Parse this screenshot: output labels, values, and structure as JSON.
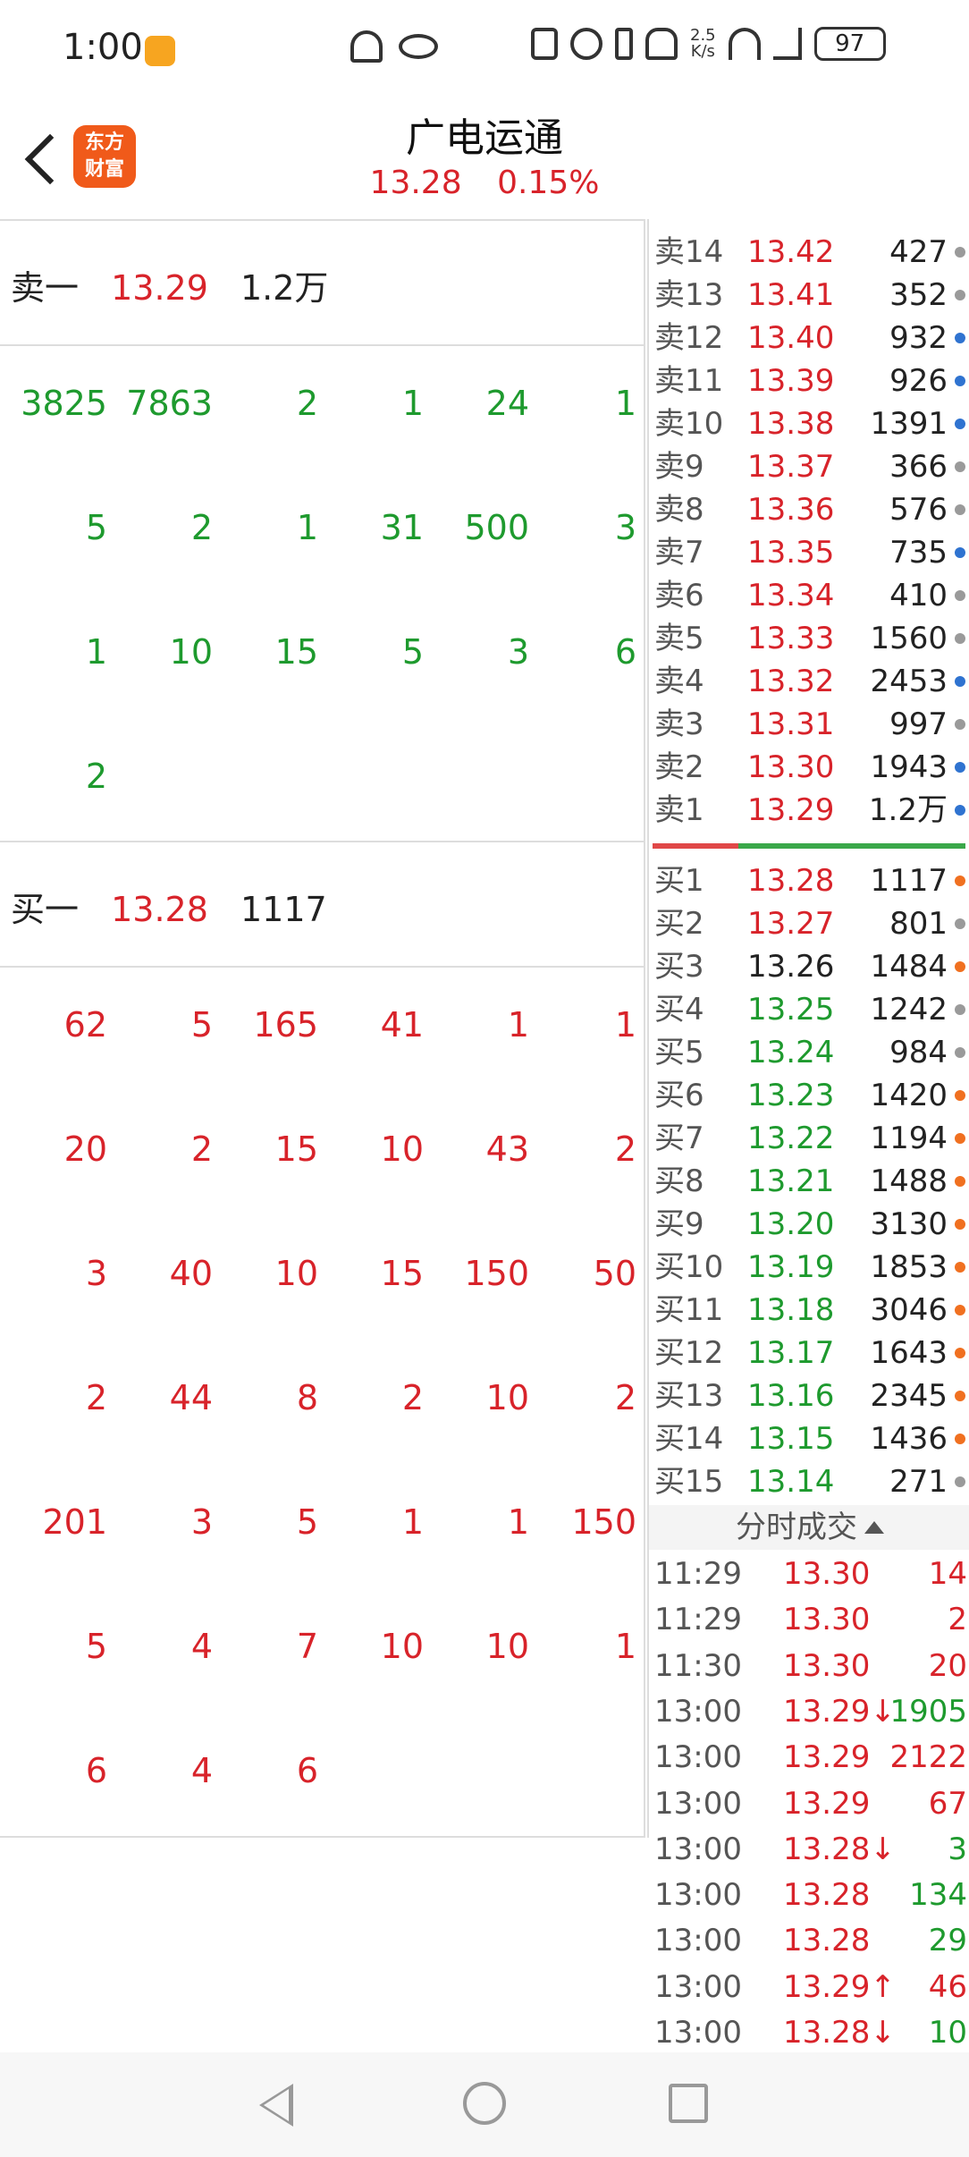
{
  "status_bar": {
    "time": "1:00",
    "net_speed_value": "2.5",
    "net_speed_unit": "K/s",
    "battery": "97"
  },
  "header": {
    "title": "广电运通",
    "price": "13.28",
    "change_pct": "0.15%",
    "logo_text_line1": "东方",
    "logo_text_line2": "财富"
  },
  "left_panel": {
    "sell": {
      "label": "卖一",
      "price": "13.29",
      "volume": "1.2万",
      "orders": [
        [
          "3825",
          "7863",
          "2",
          "1",
          "24",
          "1"
        ],
        [
          "5",
          "2",
          "1",
          "31",
          "500",
          "3"
        ],
        [
          "1",
          "10",
          "15",
          "5",
          "3",
          "6"
        ],
        [
          "2"
        ]
      ]
    },
    "buy": {
      "label": "买一",
      "price": "13.28",
      "volume": "1117",
      "orders": [
        [
          "62",
          "5",
          "165",
          "41",
          "1",
          "1"
        ],
        [
          "20",
          "2",
          "15",
          "10",
          "43",
          "2"
        ],
        [
          "3",
          "40",
          "10",
          "15",
          "150",
          "50"
        ],
        [
          "2",
          "44",
          "8",
          "2",
          "10",
          "2"
        ],
        [
          "201",
          "3",
          "5",
          "1",
          "1",
          "150"
        ],
        [
          "5",
          "4",
          "7",
          "10",
          "10",
          "1"
        ],
        [
          "6",
          "4",
          "6"
        ]
      ]
    }
  },
  "order_book": {
    "sells": [
      {
        "label": "卖14",
        "price": "13.42",
        "volume": "427",
        "dot": "gray"
      },
      {
        "label": "卖13",
        "price": "13.41",
        "volume": "352",
        "dot": "gray"
      },
      {
        "label": "卖12",
        "price": "13.40",
        "volume": "932",
        "dot": "blue"
      },
      {
        "label": "卖11",
        "price": "13.39",
        "volume": "926",
        "dot": "blue"
      },
      {
        "label": "卖10",
        "price": "13.38",
        "volume": "1391",
        "dot": "blue"
      },
      {
        "label": "卖9",
        "price": "13.37",
        "volume": "366",
        "dot": "gray"
      },
      {
        "label": "卖8",
        "price": "13.36",
        "volume": "576",
        "dot": "gray"
      },
      {
        "label": "卖7",
        "price": "13.35",
        "volume": "735",
        "dot": "blue"
      },
      {
        "label": "卖6",
        "price": "13.34",
        "volume": "410",
        "dot": "gray"
      },
      {
        "label": "卖5",
        "price": "13.33",
        "volume": "1560",
        "dot": "gray"
      },
      {
        "label": "卖4",
        "price": "13.32",
        "volume": "2453",
        "dot": "blue"
      },
      {
        "label": "卖3",
        "price": "13.31",
        "volume": "997",
        "dot": "gray"
      },
      {
        "label": "卖2",
        "price": "13.30",
        "volume": "1943",
        "dot": "blue"
      },
      {
        "label": "卖1",
        "price": "13.29",
        "volume": "1.2万",
        "dot": "blue"
      }
    ],
    "buys": [
      {
        "label": "买1",
        "price": "13.28",
        "volume": "1117",
        "dot": "orange",
        "price_color": "red"
      },
      {
        "label": "买2",
        "price": "13.27",
        "volume": "801",
        "dot": "gray",
        "price_color": "red"
      },
      {
        "label": "买3",
        "price": "13.26",
        "volume": "1484",
        "dot": "orange",
        "price_color": "dark"
      },
      {
        "label": "买4",
        "price": "13.25",
        "volume": "1242",
        "dot": "gray",
        "price_color": "green"
      },
      {
        "label": "买5",
        "price": "13.24",
        "volume": "984",
        "dot": "gray",
        "price_color": "green"
      },
      {
        "label": "买6",
        "price": "13.23",
        "volume": "1420",
        "dot": "orange",
        "price_color": "green"
      },
      {
        "label": "买7",
        "price": "13.22",
        "volume": "1194",
        "dot": "orange",
        "price_color": "green"
      },
      {
        "label": "买8",
        "price": "13.21",
        "volume": "1488",
        "dot": "orange",
        "price_color": "green"
      },
      {
        "label": "买9",
        "price": "13.20",
        "volume": "3130",
        "dot": "orange",
        "price_color": "green"
      },
      {
        "label": "买10",
        "price": "13.19",
        "volume": "1853",
        "dot": "orange",
        "price_color": "green"
      },
      {
        "label": "买11",
        "price": "13.18",
        "volume": "3046",
        "dot": "orange",
        "price_color": "green"
      },
      {
        "label": "买12",
        "price": "13.17",
        "volume": "1643",
        "dot": "orange",
        "price_color": "green"
      },
      {
        "label": "买13",
        "price": "13.16",
        "volume": "2345",
        "dot": "orange",
        "price_color": "green"
      },
      {
        "label": "买14",
        "price": "13.15",
        "volume": "1436",
        "dot": "orange",
        "price_color": "green"
      },
      {
        "label": "买15",
        "price": "13.14",
        "volume": "271",
        "dot": "gray",
        "price_color": "green"
      }
    ]
  },
  "ticks": {
    "header": "分时成交",
    "rows": [
      {
        "time": "11:29",
        "price": "13.30",
        "vol": "14",
        "vol_color": "red"
      },
      {
        "time": "11:29",
        "price": "13.30",
        "vol": "2",
        "vol_color": "red"
      },
      {
        "time": "11:30",
        "price": "13.30",
        "vol": "20",
        "vol_color": "red"
      },
      {
        "time": "13:00",
        "price": "13.29↓",
        "vol": "1905",
        "vol_color": "green"
      },
      {
        "time": "13:00",
        "price": "13.29",
        "vol": "2122",
        "vol_color": "red"
      },
      {
        "time": "13:00",
        "price": "13.29",
        "vol": "67",
        "vol_color": "red"
      },
      {
        "time": "13:00",
        "price": "13.28↓",
        "vol": "3",
        "vol_color": "green"
      },
      {
        "time": "13:00",
        "price": "13.28",
        "vol": "134",
        "vol_color": "green"
      },
      {
        "time": "13:00",
        "price": "13.28",
        "vol": "29",
        "vol_color": "green"
      },
      {
        "time": "13:00",
        "price": "13.29↑",
        "vol": "46",
        "vol_color": "red"
      },
      {
        "time": "13:00",
        "price": "13.28↓",
        "vol": "10",
        "vol_color": "green"
      }
    ]
  },
  "colors": {
    "up": "#d8232a",
    "down": "#1e9a2e",
    "brand": "#f05a1a"
  }
}
